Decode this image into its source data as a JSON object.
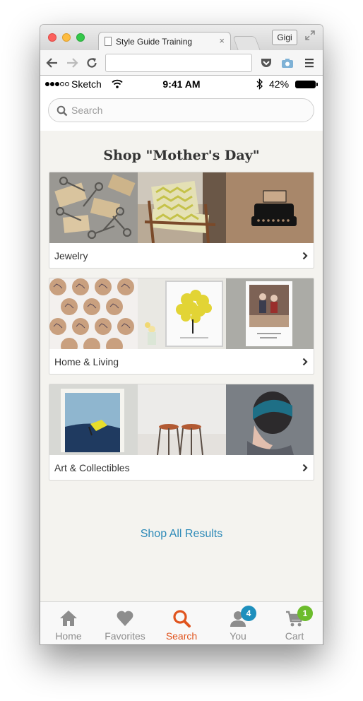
{
  "browser": {
    "tab_title": "Style Guide Training",
    "tab_close": "×",
    "profile_name": "Gigi",
    "url": ""
  },
  "status_bar": {
    "carrier": "Sketch",
    "time": "9:41 AM",
    "battery_percent": "42%"
  },
  "search": {
    "placeholder": "Search"
  },
  "main": {
    "heading": "Shop \"Mother's Day\"",
    "categories": [
      {
        "label": "Jewelry",
        "images": [
          "skeleton-keys-photo",
          "chevron-chair-photo",
          "typewriter-print-photo"
        ]
      },
      {
        "label": "Home & Living",
        "images": [
          "heart-stickers-photo",
          "fingerprint-tree-print-photo",
          "couple-photo-print"
        ]
      },
      {
        "label": "Art & Collectibles",
        "images": [
          "abstract-painting-photo",
          "wooden-stools-photo",
          "teal-headband-photo"
        ]
      }
    ],
    "shop_all_label": "Shop All Results"
  },
  "tab_bar": {
    "items": [
      {
        "label": "Home",
        "icon": "home-icon",
        "active": false
      },
      {
        "label": "Favorites",
        "icon": "heart-icon",
        "active": false
      },
      {
        "label": "Search",
        "icon": "search-icon",
        "active": true
      },
      {
        "label": "You",
        "icon": "person-icon",
        "active": false,
        "badge": "4"
      },
      {
        "label": "Cart",
        "icon": "cart-icon",
        "active": false,
        "badge": "1"
      }
    ]
  },
  "colors": {
    "accent_orange": "#e0541e",
    "link_blue": "#2d8ab8",
    "badge_blue": "#1e8fbd",
    "badge_green": "#6cbc2c"
  }
}
